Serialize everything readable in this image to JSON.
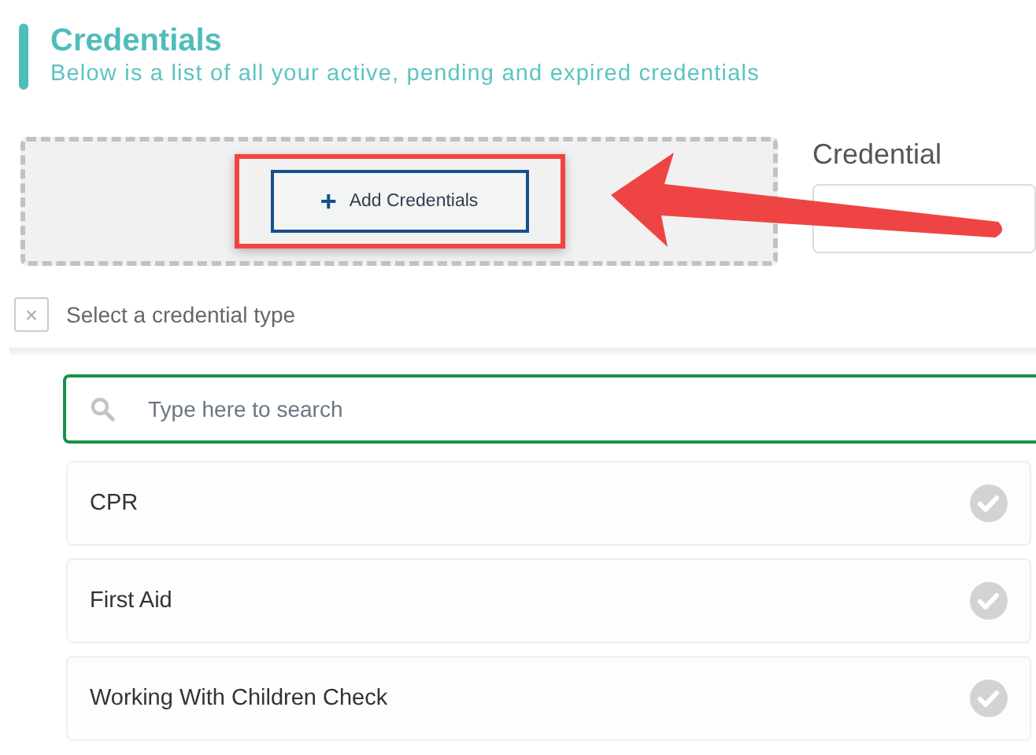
{
  "header": {
    "title": "Credentials",
    "subtitle": "Below is a list of all your active, pending and expired credentials"
  },
  "add_button": {
    "icon": "+",
    "label": "Add Credentials",
    "highlighted": true
  },
  "filter": {
    "label": "Credential"
  },
  "type_picker": {
    "close": "×",
    "label": "Select a credential type"
  },
  "search": {
    "placeholder": "Type here to search"
  },
  "items": [
    {
      "label": "CPR",
      "selected": false
    },
    {
      "label": "First Aid",
      "selected": false
    },
    {
      "label": "Working With Children Check",
      "selected": false
    }
  ]
}
